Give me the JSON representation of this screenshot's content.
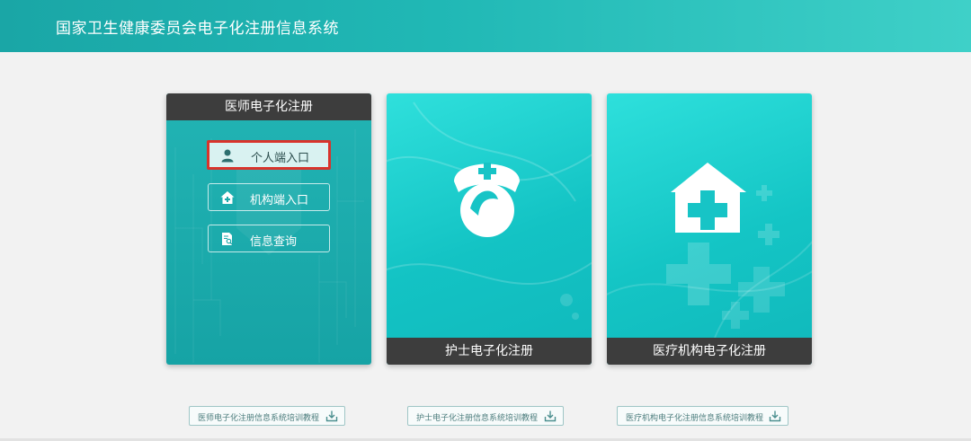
{
  "header": {
    "title": "国家卫生健康委员会电子化注册信息系统"
  },
  "cards": {
    "doctor": {
      "title": "医师电子化注册",
      "buttons": {
        "personal": "个人端入口",
        "institution": "机构端入口",
        "query": "信息查询"
      }
    },
    "nurse": {
      "title": "护士电子化注册"
    },
    "institution": {
      "title": "医疗机构电子化注册"
    }
  },
  "tutorials": {
    "doctor": "医师电子化注册信息系统培训教程",
    "nurse": "护士电子化注册信息系统培训教程",
    "institution": "医疗机构电子化注册信息系统培训教程"
  },
  "colors": {
    "header_start": "#1aa6a6",
    "header_end": "#3fd0c8",
    "card_teal": "#16a3a5",
    "card_bright": "#13c3c4",
    "card_label_bg": "#3d3d3d",
    "highlight_border": "#d8342c"
  },
  "icons": {
    "personal": "person-icon",
    "institution": "house-icon",
    "query": "search-document-icon",
    "nurse": "nurse-cap-icon",
    "hospital": "hospital-house-icon",
    "download": "download-icon"
  }
}
